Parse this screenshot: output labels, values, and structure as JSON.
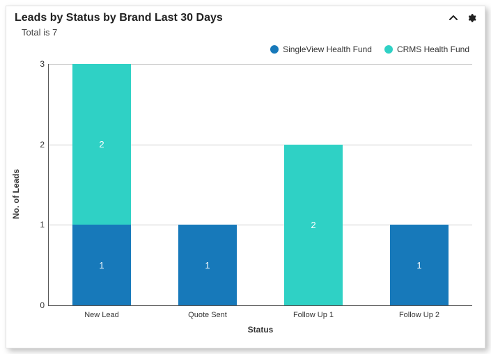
{
  "header": {
    "title": "Leads by Status by Brand Last 30 Days"
  },
  "subheader": "Total is 7",
  "legend": [
    {
      "name": "SingleView Health Fund",
      "color": "#1779ba"
    },
    {
      "name": "CRMS Health Fund",
      "color": "#2fd1c5"
    }
  ],
  "chart_data": {
    "type": "bar",
    "stacked": true,
    "title": "Leads by Status by Brand Last 30 Days",
    "xlabel": "Status",
    "ylabel": "No. of Leads",
    "ylim": [
      0,
      3
    ],
    "yticks": [
      0,
      1,
      2,
      3
    ],
    "categories": [
      "New Lead",
      "Quote Sent",
      "Follow Up 1",
      "Follow Up 2"
    ],
    "series": [
      {
        "name": "SingleView Health Fund",
        "color": "#1779ba",
        "values": [
          1,
          1,
          0,
          1
        ]
      },
      {
        "name": "CRMS Health Fund",
        "color": "#2fd1c5",
        "values": [
          2,
          0,
          2,
          0
        ]
      }
    ]
  }
}
